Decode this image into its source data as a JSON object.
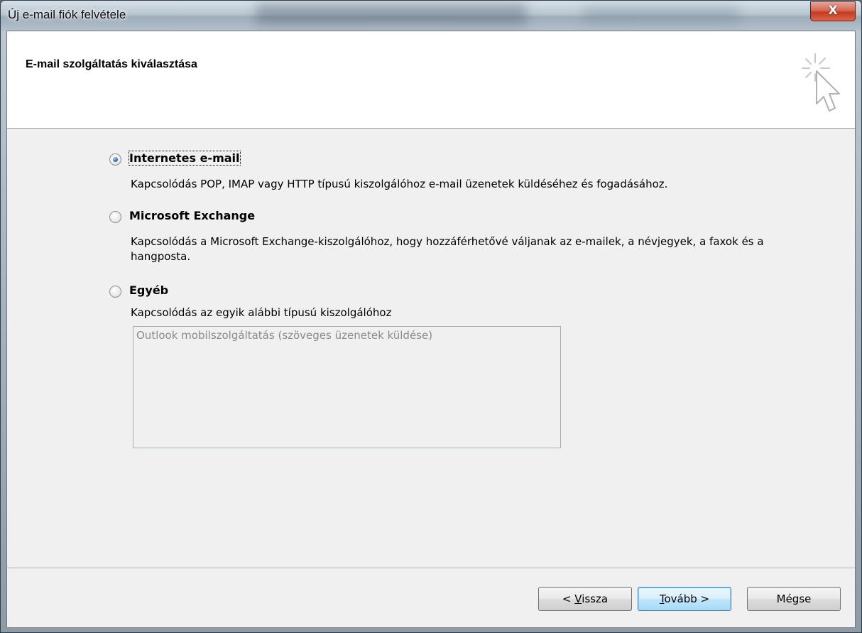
{
  "window": {
    "title": "Új e-mail fiók felvétele",
    "close_label": "X"
  },
  "header": {
    "title": "E-mail szolgáltatás kiválasztása",
    "icon": "wizard-cursor-icon"
  },
  "options": [
    {
      "label": "Internetes e-mail",
      "description": "Kapcsolódás POP, IMAP vagy HTTP típusú kiszolgálóhoz e-mail üzenetek küldéséhez és fogadásához.",
      "checked": true
    },
    {
      "label": "Microsoft Exchange",
      "description": "Kapcsolódás a Microsoft Exchange-kiszolgálóhoz, hogy hozzáférhetővé váljanak az e-mailek, a névjegyek, a faxok és a hangposta.",
      "checked": false
    },
    {
      "label": "Egyéb",
      "description": "Kapcsolódás az egyik alábbi típusú kiszolgálóhoz",
      "checked": false
    }
  ],
  "other_list": {
    "items": [
      "Outlook mobilszolgáltatás (szöveges üzenetek küldése)"
    ]
  },
  "buttons": {
    "back_prefix": "< ",
    "back_mnemonic": "V",
    "back_rest": "issza",
    "next_mnemonic": "T",
    "next_rest": "ovább >",
    "cancel": "Mégse"
  },
  "colors": {
    "accent": "#3c7fb1",
    "dialog_bg": "#f0f0f0",
    "close_red": "#c63a1f"
  }
}
